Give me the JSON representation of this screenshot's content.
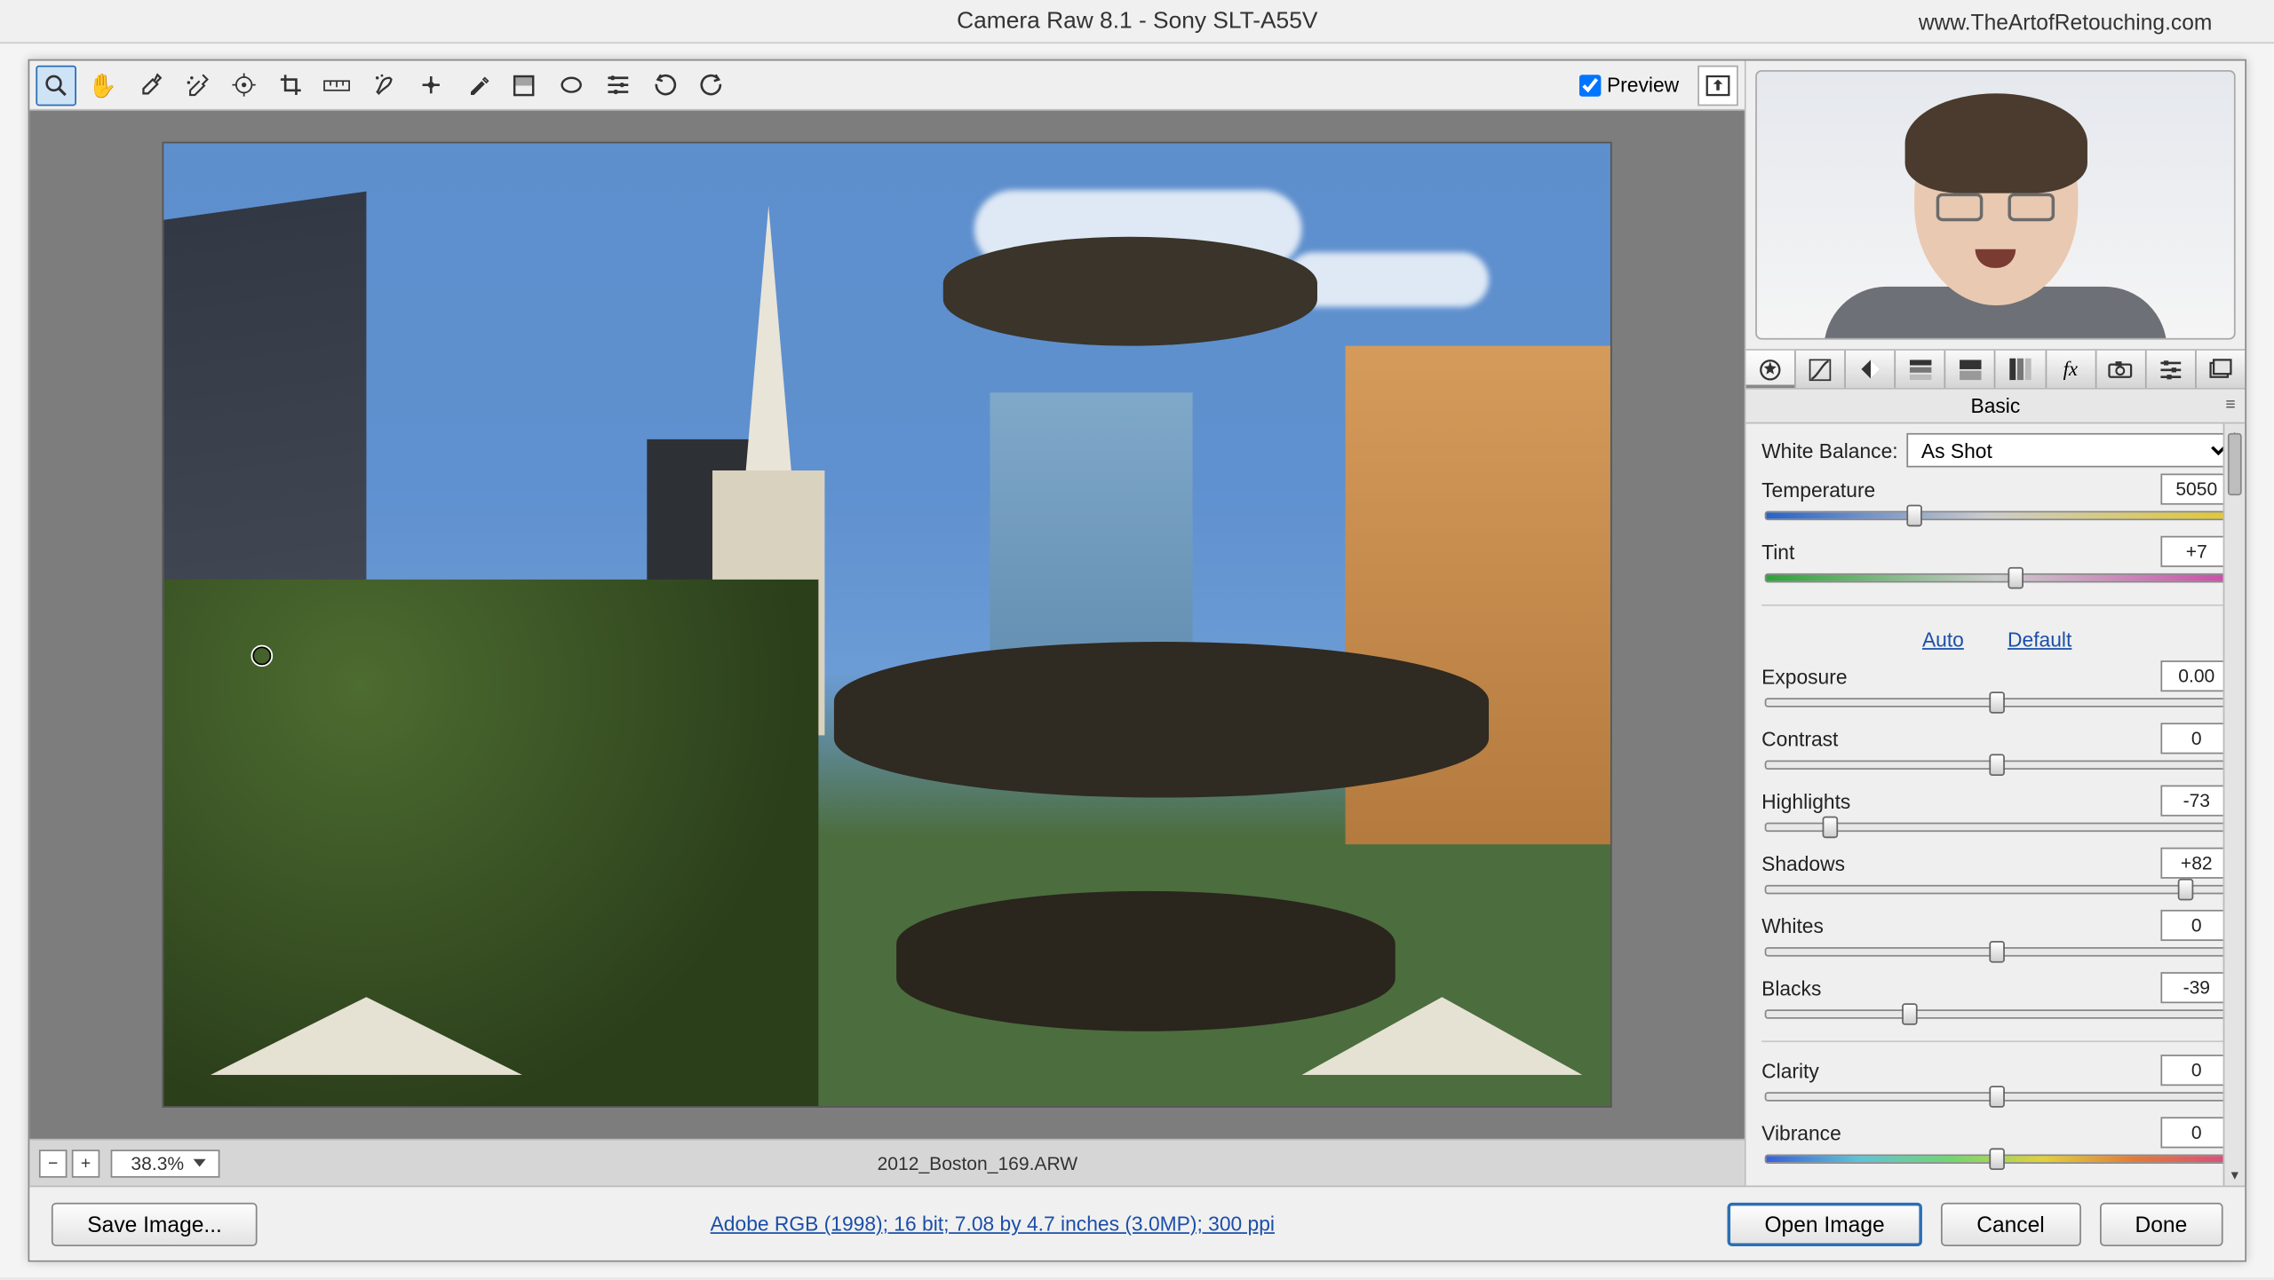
{
  "title": "Camera Raw 8.1  -  Sony SLT-A55V",
  "url_watermark": "www.TheArtofRetouching.com",
  "toolbar": {
    "preview_label": "Preview",
    "tools": [
      "zoom",
      "hand",
      "eyedropper",
      "sampler",
      "target",
      "crop",
      "straighten",
      "spot",
      "redeye",
      "brush",
      "oval",
      "radial",
      "list",
      "rotate-ccw",
      "rotate-cw"
    ]
  },
  "zoom": {
    "minus": "−",
    "plus": "+",
    "value": "38.3%"
  },
  "filename": "2012_Boston_169.ARW",
  "panel_tabs": [
    "basic",
    "curve",
    "detail",
    "hsl",
    "split",
    "lens",
    "fx",
    "camera",
    "presets",
    "snap"
  ],
  "panel_title": "Basic",
  "wb": {
    "label": "White Balance:",
    "value": "As Shot"
  },
  "sliders": {
    "temperature": {
      "label": "Temperature",
      "value": "5050",
      "pos": 32,
      "track": "temp"
    },
    "tint": {
      "label": "Tint",
      "value": "+7",
      "pos": 54,
      "track": "tint"
    },
    "exposure": {
      "label": "Exposure",
      "value": "0.00",
      "pos": 50
    },
    "contrast": {
      "label": "Contrast",
      "value": "0",
      "pos": 50
    },
    "highlights": {
      "label": "Highlights",
      "value": "-73",
      "pos": 14
    },
    "shadows": {
      "label": "Shadows",
      "value": "+82",
      "pos": 91
    },
    "whites": {
      "label": "Whites",
      "value": "0",
      "pos": 50
    },
    "blacks": {
      "label": "Blacks",
      "value": "-39",
      "pos": 31
    },
    "clarity": {
      "label": "Clarity",
      "value": "0",
      "pos": 50
    },
    "vibrance": {
      "label": "Vibrance",
      "value": "0",
      "pos": 50,
      "track": "vib"
    }
  },
  "links": {
    "auto": "Auto",
    "default": "Default"
  },
  "workflow": "Adobe RGB (1998); 16 bit; 7.08 by 4.7 inches (3.0MP); 300 ppi",
  "buttons": {
    "save": "Save Image...",
    "open": "Open Image",
    "cancel": "Cancel",
    "done": "Done"
  }
}
